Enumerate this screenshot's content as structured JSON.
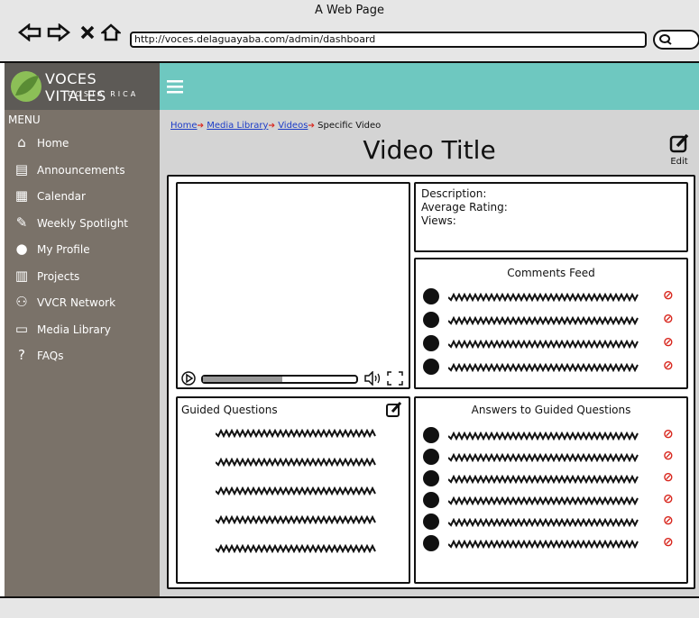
{
  "browser": {
    "title": "A Web Page",
    "url": "http://voces.delaguayaba.com/admin/dashboard",
    "back_icon": "back-arrow-icon",
    "forward_icon": "forward-arrow-icon",
    "close_icon": "close-icon",
    "home_icon": "home-icon"
  },
  "logo": {
    "name": "VOCES VITALES",
    "sub": "COSTA RICA"
  },
  "sidebar": {
    "menu_label": "MENU",
    "items": [
      {
        "label": "Home",
        "icon": "home-icon"
      },
      {
        "label": "Announcements",
        "icon": "announcements-icon"
      },
      {
        "label": "Calendar",
        "icon": "calendar-icon"
      },
      {
        "label": "Weekly Spotlight",
        "icon": "spotlight-icon"
      },
      {
        "label": "My Profile",
        "icon": "profile-icon"
      },
      {
        "label": "Projects",
        "icon": "projects-icon"
      },
      {
        "label": "VVCR Network",
        "icon": "network-icon"
      },
      {
        "label": "Media Library",
        "icon": "monitor-icon"
      },
      {
        "label": "FAQs",
        "icon": "help-icon"
      }
    ]
  },
  "breadcrumb": [
    "Home",
    "Media Library",
    "Videos",
    "Specific Video"
  ],
  "page": {
    "title": "Video Title",
    "edit_label": "Edit"
  },
  "details": {
    "description_label": "Description:",
    "rating_label": "Average Rating:",
    "views_label": "Views:"
  },
  "comments": {
    "title": "Comments Feed"
  },
  "guided": {
    "title": "Guided Questions"
  },
  "answers": {
    "title": "Answers to Guided Questions"
  },
  "colors": {
    "header": "#6ec8c0",
    "sidebar": "#7a7269",
    "logo_bg": "#5d5a56",
    "delete": "#d8261d"
  }
}
